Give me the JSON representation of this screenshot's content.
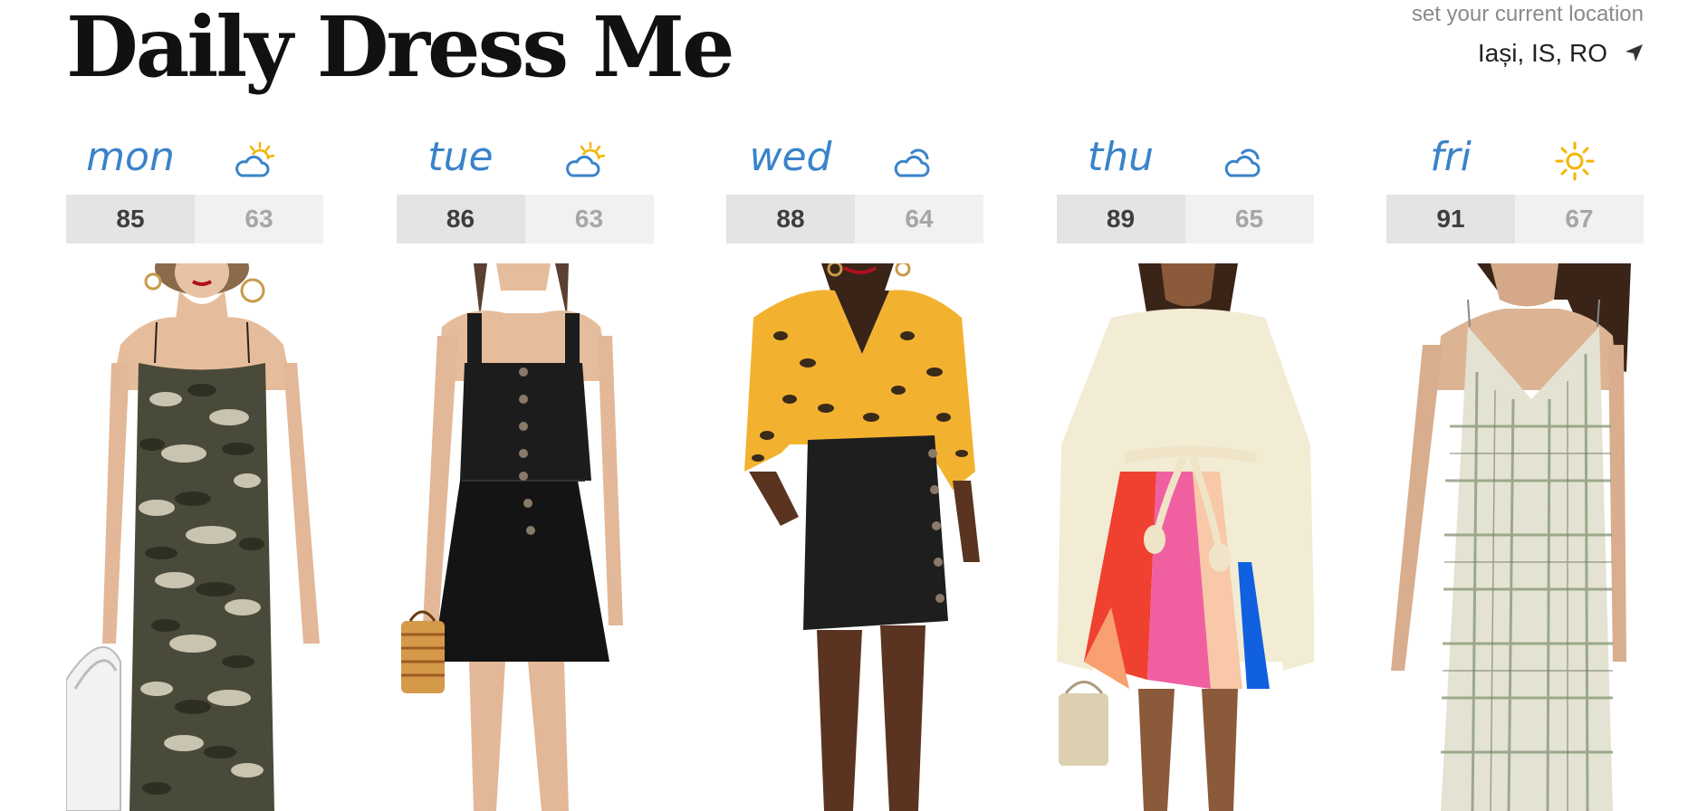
{
  "header": {
    "brand": "Daily Dress Me",
    "location_prompt": "set your current location",
    "location_city": "Iași, IS, RO",
    "location_icon": "location-arrow-icon"
  },
  "colors": {
    "accent": "#3a83c9",
    "sun": "#f5b400",
    "cloud": "#3a83c9"
  },
  "forecast": [
    {
      "day": "mon",
      "icon": "partly-cloudy-icon",
      "high": "85",
      "low": "63",
      "outfit": "camo-slip-dress"
    },
    {
      "day": "tue",
      "icon": "partly-cloudy-icon",
      "high": "86",
      "low": "63",
      "outfit": "black-button-dress"
    },
    {
      "day": "wed",
      "icon": "cloudy-icon",
      "high": "88",
      "low": "64",
      "outfit": "leopard-blouse-denim-skirt"
    },
    {
      "day": "thu",
      "icon": "cloudy-icon",
      "high": "89",
      "low": "65",
      "outfit": "cream-rainbow-dress"
    },
    {
      "day": "fri",
      "icon": "sunny-icon",
      "high": "91",
      "low": "67",
      "outfit": "plaid-slip-dress"
    }
  ]
}
